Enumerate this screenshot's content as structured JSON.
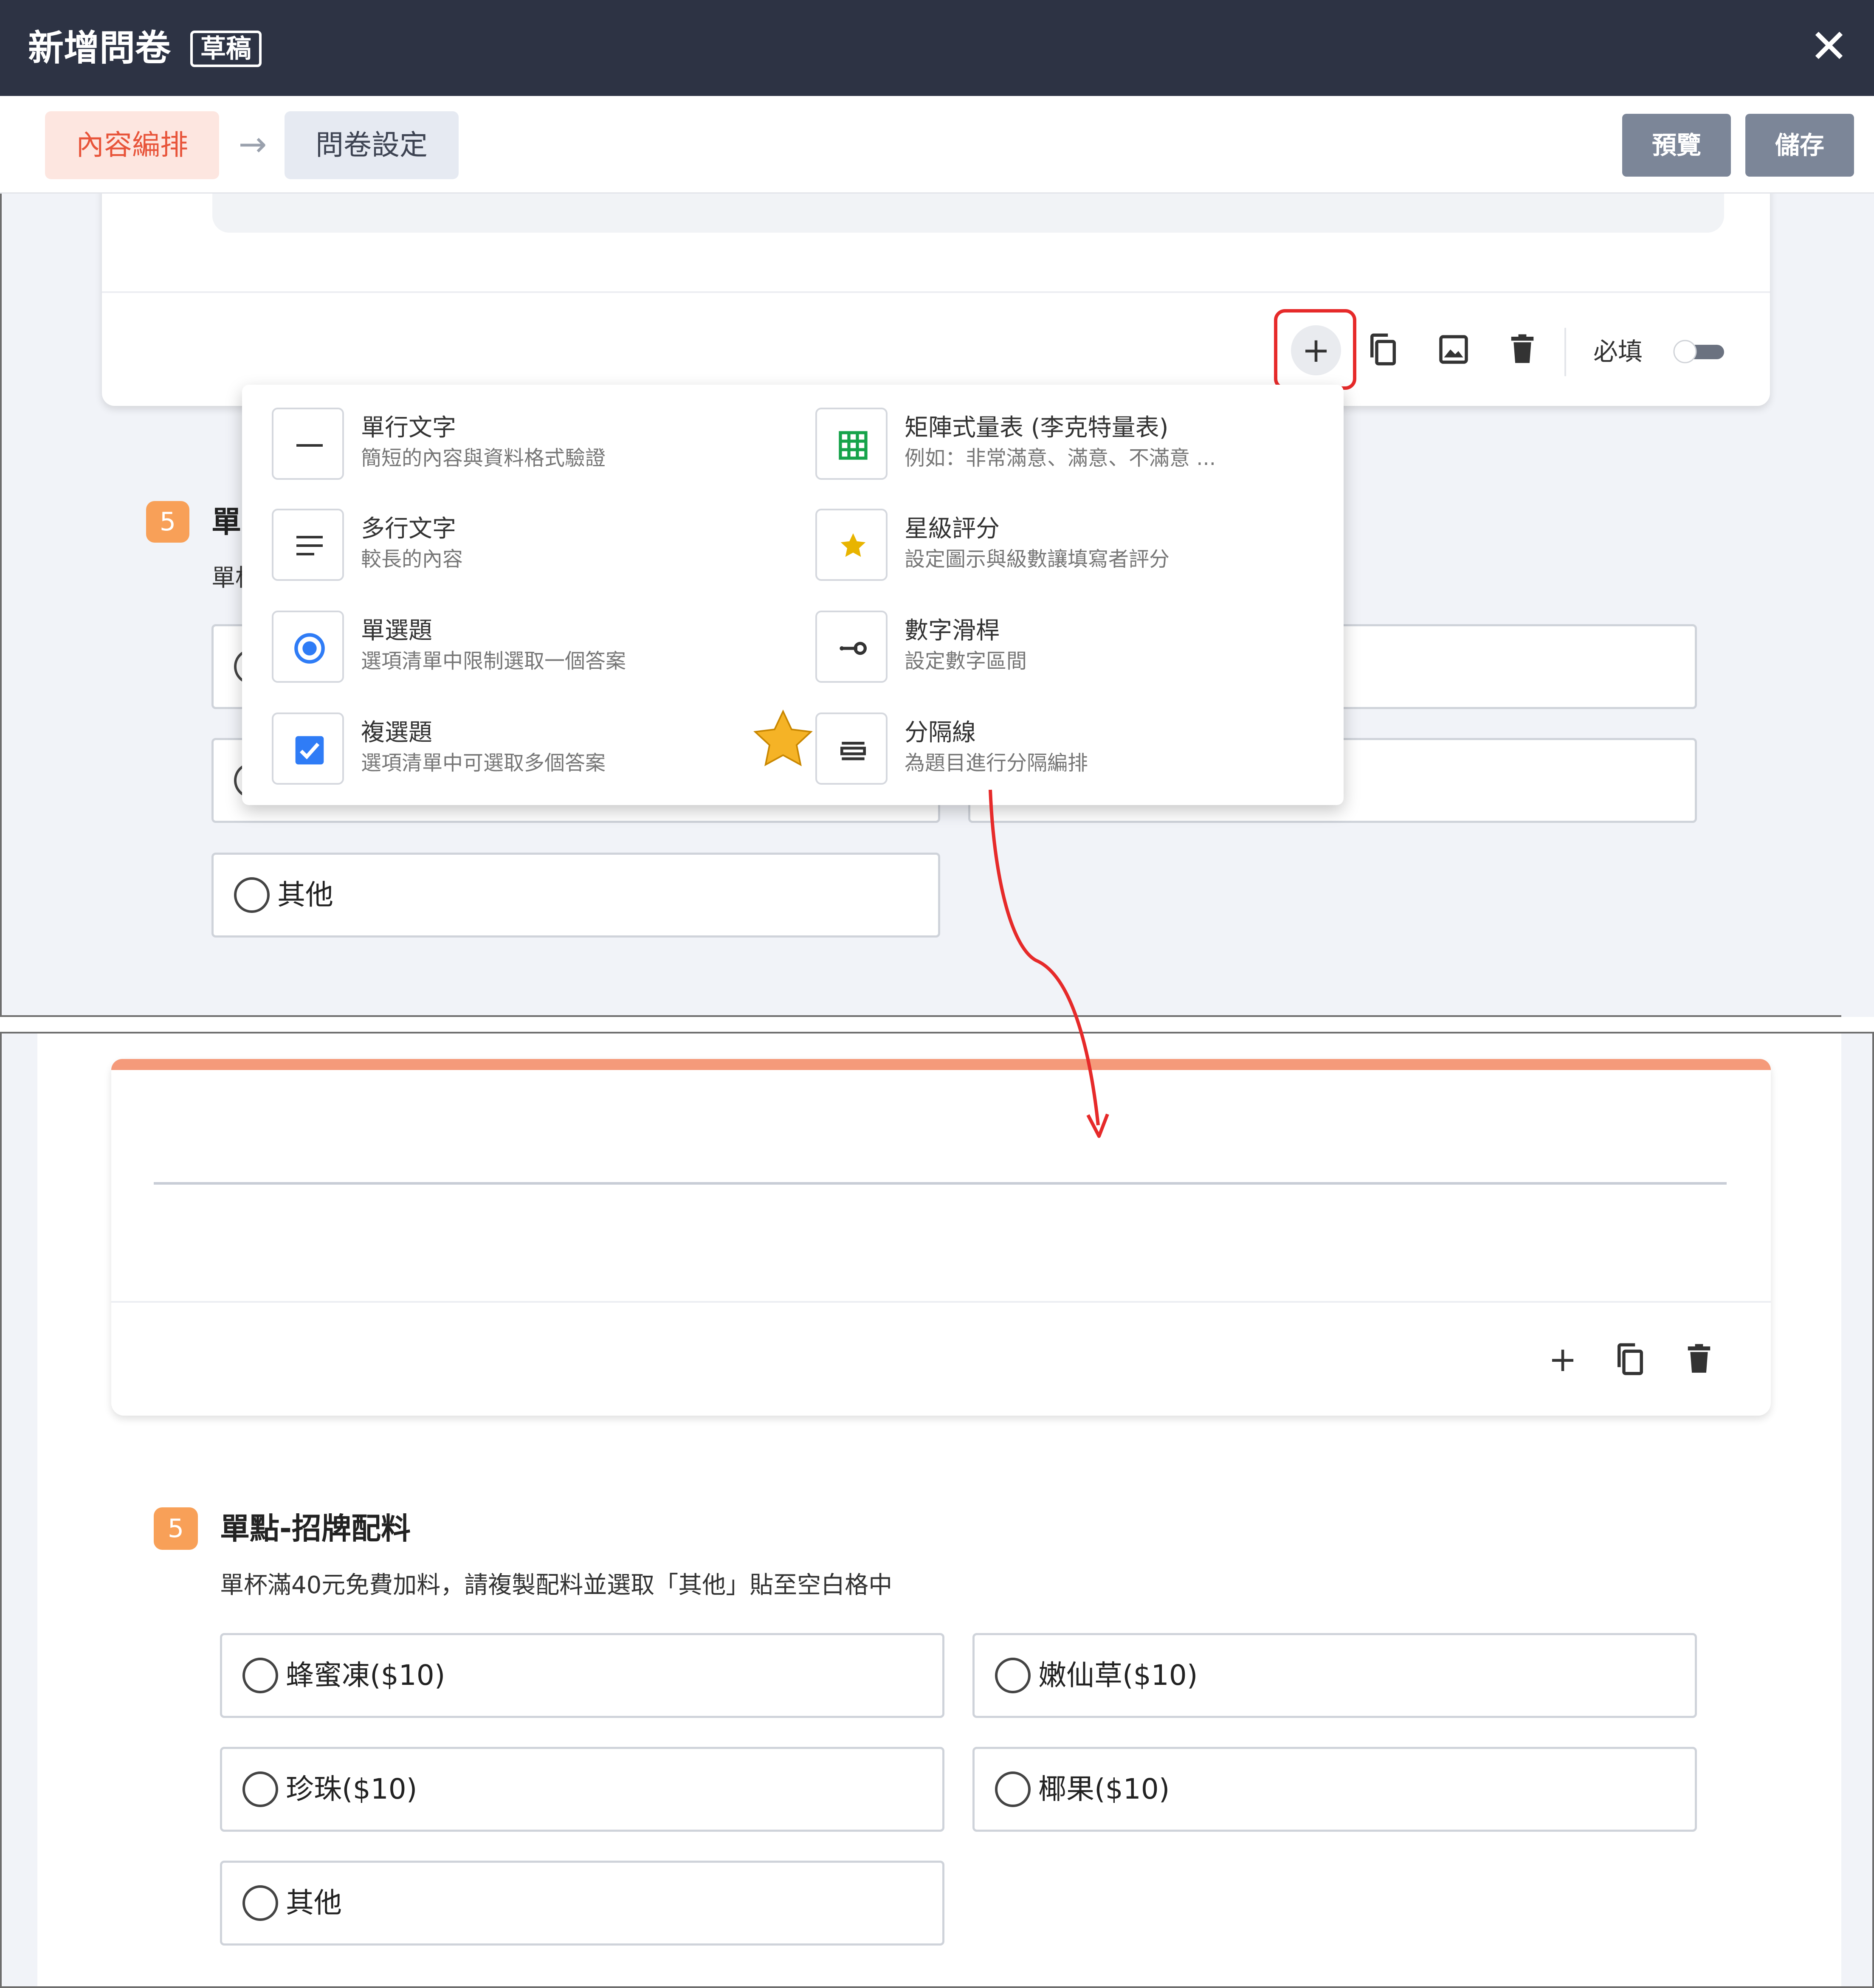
{
  "header": {
    "title": "新增問卷",
    "badge": "草稿"
  },
  "steps": {
    "content": "內容編排",
    "settings": "問卷設定"
  },
  "actions": {
    "preview": "預覽",
    "save": "儲存"
  },
  "toolbar": {
    "required_label": "必填"
  },
  "add_question_menu": {
    "items": [
      {
        "icon": "single-line-icon",
        "title": "單行文字",
        "desc": "簡短的內容與資料格式驗證"
      },
      {
        "icon": "multi-line-icon",
        "title": "多行文字",
        "desc": "較長的內容"
      },
      {
        "icon": "radio-icon",
        "title": "單選題",
        "desc": "選項清單中限制選取一個答案"
      },
      {
        "icon": "checkbox-icon",
        "title": "複選題",
        "desc": "選項清單中可選取多個答案"
      },
      {
        "icon": "matrix-icon",
        "title": "矩陣式量表 (李克特量表)",
        "desc": "例如：非常滿意、滿意、不滿意 ..."
      },
      {
        "icon": "star-icon",
        "title": "星級評分",
        "desc": "設定圖示與級數讓填寫者評分"
      },
      {
        "icon": "slider-icon",
        "title": "數字滑桿",
        "desc": "設定數字區間"
      },
      {
        "icon": "divider-icon",
        "title": "分隔線",
        "desc": "為題目進行分隔編排"
      }
    ]
  },
  "partial_question": {
    "number": "5",
    "title_fragment": "單",
    "sub_fragment": "單杯",
    "other_option": "其他"
  },
  "question": {
    "number": "5",
    "title": "單點-招牌配料",
    "description": "單杯滿40元免費加料，請複製配料並選取「其他」貼至空白格中",
    "options": [
      "蜂蜜凍($10)",
      "嫩仙草($10)",
      "珍珠($10)",
      "椰果($10)",
      "其他"
    ]
  },
  "colors": {
    "header_bg": "#2d3344",
    "accent": "#e8543a",
    "badge_orange": "#f8a058",
    "highlight_red": "#e62a2a",
    "divider_card_top": "#f59a7a"
  }
}
